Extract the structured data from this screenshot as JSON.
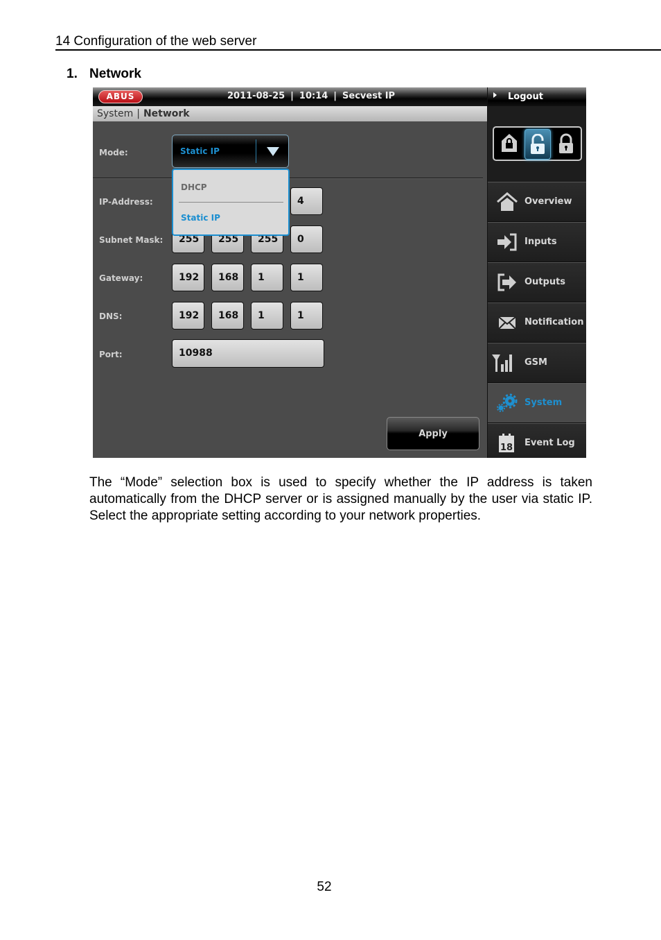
{
  "document": {
    "chapter_header": "14  Configuration of the web server",
    "section_number": "1.",
    "section_title": "Network",
    "body_text": "The “Mode” selection box is used to specify whether the IP address is taken automatically from the DHCP server or is assigned manually by the user via static IP. Select the appropriate setting according to your network properties.",
    "page_number": "52"
  },
  "app": {
    "logo_text": "ABUS",
    "topbar": {
      "date": "2011-08-25",
      "time": "10:14",
      "product": "Secvest IP",
      "separator": "|"
    },
    "logout_label": "Logout",
    "breadcrumb": {
      "parent": "System",
      "separator": "|",
      "current": "Network"
    },
    "lock_modes": [
      {
        "icon": "home-lock-icon",
        "active": false
      },
      {
        "icon": "unlock-icon",
        "active": true
      },
      {
        "icon": "lock-icon",
        "active": false
      }
    ],
    "nav": [
      {
        "label": "Overview",
        "icon": "home-icon",
        "active": false
      },
      {
        "label": "Inputs",
        "icon": "input-icon",
        "active": false
      },
      {
        "label": "Outputs",
        "icon": "output-icon",
        "active": false
      },
      {
        "label": "Notification",
        "icon": "envelope-icon",
        "active": false
      },
      {
        "label": "GSM",
        "icon": "signal-icon",
        "active": false
      },
      {
        "label": "System",
        "icon": "gears-icon",
        "active": true
      },
      {
        "label": "Event Log",
        "icon": "calendar-icon",
        "active": false,
        "calendar_day": "18"
      }
    ],
    "form": {
      "mode": {
        "label": "Mode:",
        "value": "Static IP",
        "options": [
          "DHCP",
          "Static IP"
        ]
      },
      "ip_address": {
        "label": "IP-Address:",
        "octets": [
          "",
          "",
          "",
          "4"
        ]
      },
      "subnet_mask": {
        "label": "Subnet Mask:",
        "octets": [
          "255",
          "255",
          "255",
          "0"
        ]
      },
      "gateway": {
        "label": "Gateway:",
        "octets": [
          "192",
          "168",
          "1",
          "1"
        ]
      },
      "dns": {
        "label": "DNS:",
        "octets": [
          "192",
          "168",
          "1",
          "1"
        ]
      },
      "port": {
        "label": "Port:",
        "value": "10988"
      },
      "apply_label": "Apply"
    },
    "colors": {
      "accent_blue": "#1e90d0",
      "logo_red": "#c8141c",
      "panel_bg": "#4b4b4b",
      "sidebar_bg": "#1d1d1d"
    }
  }
}
